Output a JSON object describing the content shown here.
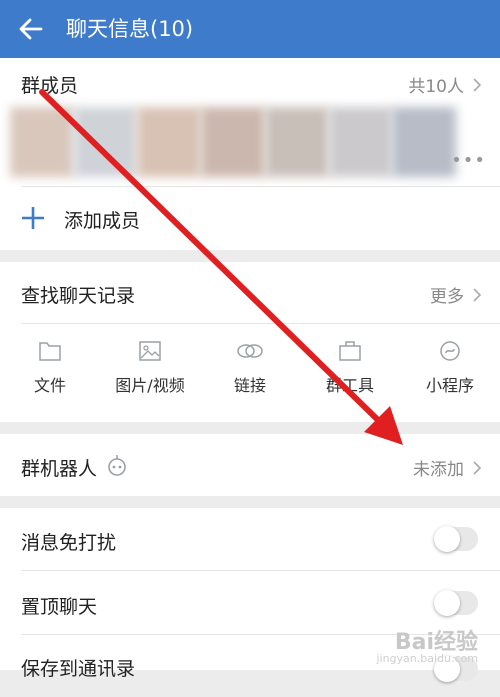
{
  "header": {
    "title": "聊天信息(10)"
  },
  "members": {
    "label": "群成员",
    "count_text": "共10人",
    "avatar_colors": [
      "#d9c7bc",
      "#cfd3d8",
      "#d8c2b4",
      "#cbb7ad",
      "#c8bfb8",
      "#cbc9cc",
      "#b7bcc7"
    ]
  },
  "add_member": {
    "label": "添加成员"
  },
  "search": {
    "label": "查找聊天记录",
    "more": "更多"
  },
  "tools": [
    {
      "icon": "folder-icon",
      "label": "文件"
    },
    {
      "icon": "image-icon",
      "label": "图片/视频"
    },
    {
      "icon": "link-icon",
      "label": "链接"
    },
    {
      "icon": "briefcase-icon",
      "label": "群工具"
    },
    {
      "icon": "mini-program-icon",
      "label": "小程序"
    }
  ],
  "robot": {
    "label": "群机器人",
    "status": "未添加"
  },
  "settings": [
    {
      "label": "消息免打扰",
      "enabled": false
    },
    {
      "label": "置顶聊天",
      "enabled": false
    },
    {
      "label": "保存到通讯录",
      "enabled": false
    }
  ],
  "watermark": {
    "text": "Bai经验",
    "sub": "jingyan.baidu.com"
  },
  "colors": {
    "header": "#3f7bcb",
    "accent": "#3f7bcb",
    "annotation": "#e02020"
  }
}
